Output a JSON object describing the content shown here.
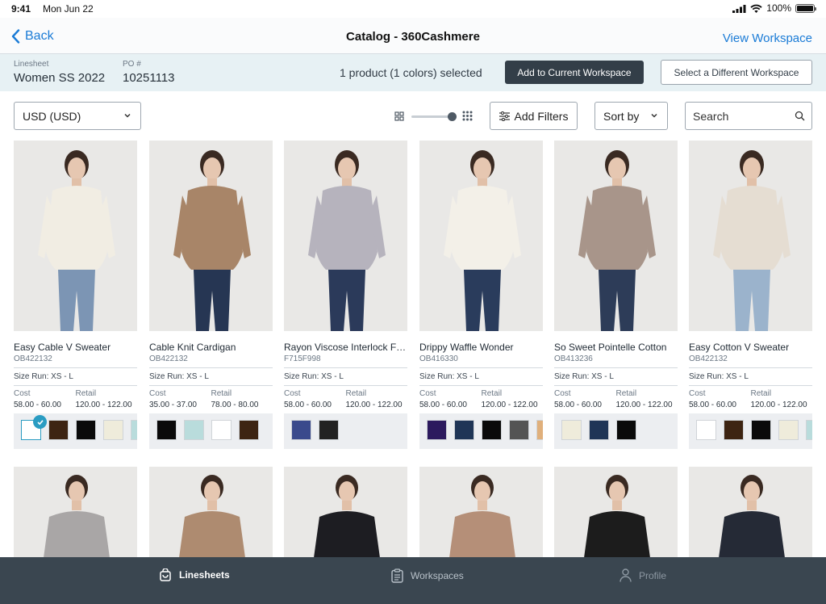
{
  "status_bar": {
    "time": "9:41",
    "date": "Mon Jun 22",
    "battery": "100%"
  },
  "nav": {
    "back_label": "Back",
    "title": "Catalog - 360Cashmere",
    "right_action": "View Workspace"
  },
  "selection_bar": {
    "linesheet_label": "Linesheet",
    "linesheet_value": "Women SS 2022",
    "po_label": "PO #",
    "po_value": "10251113",
    "selection_text": "1 product (1 colors) selected",
    "add_button": "Add to Current Workspace",
    "select_button": "Select a Different Workspace"
  },
  "toolbar": {
    "currency": "USD (USD)",
    "zoom_level": 1.0,
    "filters_label": "Add Filters",
    "sort_label": "Sort by",
    "search_placeholder": "Search"
  },
  "products": [
    {
      "name": "Easy Cable V Sweater",
      "sku": "OB422132",
      "size_run": "Size Run: XS - L",
      "cost_label": "Cost",
      "cost": "58.00 - 60.00",
      "retail_label": "Retail",
      "retail": "120.00 - 122.00",
      "top_color": "#f1ede3",
      "bottom_color": "#7c95b4",
      "swatches": [
        "#ffffff",
        "#3d2412",
        "#0a0a0a",
        "#efecdb",
        "#b9dcdc"
      ],
      "selected_swatch": 0
    },
    {
      "name": "Cable Knit Cardigan",
      "sku": "OB422132",
      "size_run": "Size Run: XS - L",
      "cost_label": "Cost",
      "cost": "35.00 - 37.00",
      "retail_label": "Retail",
      "retail": "78.00 - 80.00",
      "top_color": "#a88568",
      "bottom_color": "#263653",
      "swatches": [
        "#0a0a0a",
        "#b9dcdc",
        "#ffffff",
        "#3d2412"
      ],
      "selected_swatch": -1
    },
    {
      "name": "Rayon Viscose Interlock Fine Gauge",
      "sku": "F715F998",
      "size_run": "Size Run: XS - L",
      "cost_label": "Cost",
      "cost": "58.00 - 60.00",
      "retail_label": "Retail",
      "retail": "120.00 - 122.00",
      "top_color": "#b6b3bd",
      "bottom_color": "#2b3a5a",
      "swatches": [
        "#3a4a8c",
        "#222222"
      ],
      "selected_swatch": -1
    },
    {
      "name": "Drippy Waffle Wonder",
      "sku": "OB416330",
      "size_run": "Size Run: XS - L",
      "cost_label": "Cost",
      "cost": "58.00 - 60.00",
      "retail_label": "Retail",
      "retail": "120.00 - 122.00",
      "top_color": "#f3f0e8",
      "bottom_color": "#2a3c5c",
      "swatches": [
        "#2c1a5e",
        "#1f3556",
        "#0a0a0a",
        "#545454",
        "#e0b07c"
      ],
      "selected_swatch": -1
    },
    {
      "name": "So Sweet Pointelle Cotton",
      "sku": "OB413236",
      "size_run": "Size Run: XS - L",
      "cost_label": "Cost",
      "cost": "58.00 - 60.00",
      "retail_label": "Retail",
      "retail": "120.00 - 122.00",
      "top_color": "#a8958a",
      "bottom_color": "#2d3c58",
      "swatches": [
        "#efecdb",
        "#1f3556",
        "#0a0a0a"
      ],
      "selected_swatch": -1
    },
    {
      "name": "Easy Cotton V Sweater",
      "sku": "OB422132",
      "size_run": "Size Run: XS - L",
      "cost_label": "Cost",
      "cost": "58.00 - 60.00",
      "retail_label": "Retail",
      "retail": "120.00 - 122.00",
      "top_color": "#e5ddd2",
      "bottom_color": "#9bb3cc",
      "swatches": [
        "#ffffff",
        "#3d2412",
        "#0a0a0a",
        "#efecdb",
        "#b9dcdc"
      ],
      "selected_swatch": -1
    }
  ],
  "row2_colors": [
    "#a9a6a6",
    "#ae8b70",
    "#1d1d22",
    "#b58f78",
    "#1c1c1c",
    "#252a36"
  ],
  "tabs": [
    {
      "label": "Linesheets",
      "icon": "bag-icon",
      "state": "active"
    },
    {
      "label": "Workspaces",
      "icon": "clipboard-icon",
      "state": "inactive"
    },
    {
      "label": "Profile",
      "icon": "person-icon",
      "state": "dim"
    }
  ]
}
